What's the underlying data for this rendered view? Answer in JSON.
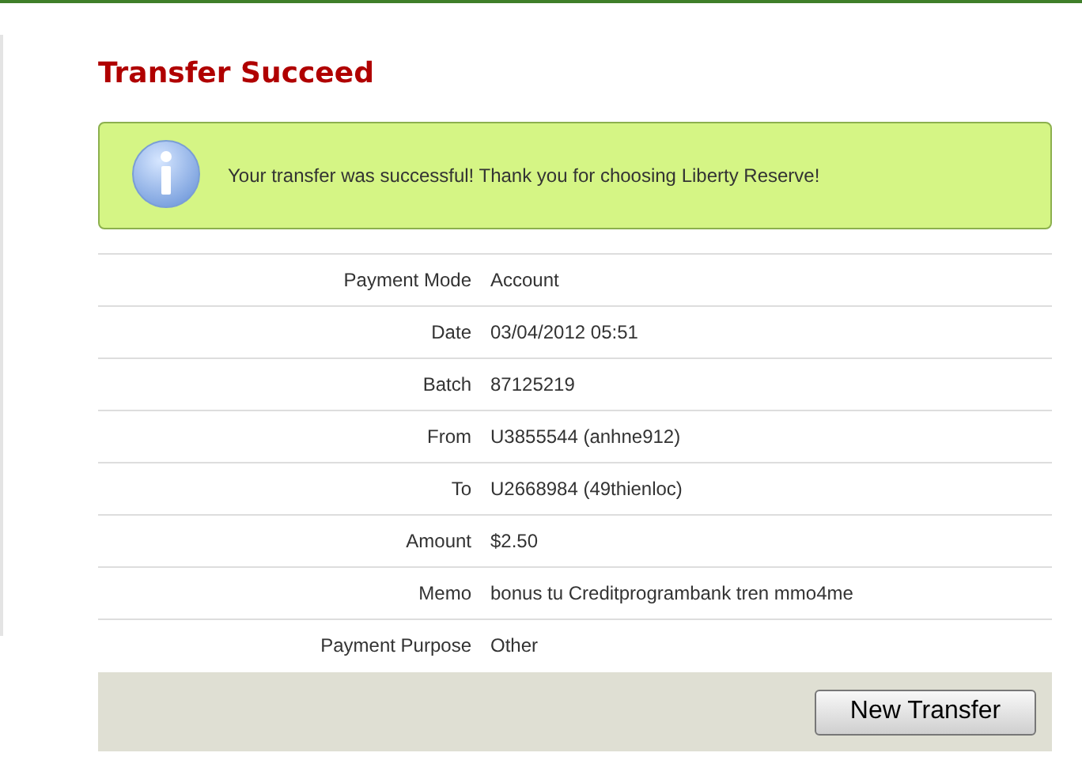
{
  "title": "Transfer Succeed",
  "message": "Your transfer was successful! Thank you for choosing Liberty Reserve!",
  "details": [
    {
      "label": "Payment Mode",
      "value": "Account"
    },
    {
      "label": "Date",
      "value": "03/04/2012 05:51"
    },
    {
      "label": "Batch",
      "value": "87125219"
    },
    {
      "label": "From",
      "value": "U3855544 (anhne912)"
    },
    {
      "label": "To",
      "value": "U2668984 (49thienloc)"
    },
    {
      "label": "Amount",
      "value": "$2.50"
    },
    {
      "label": "Memo",
      "value": "bonus tu Creditprogrambank tren mmo4me"
    },
    {
      "label": "Payment Purpose",
      "value": "Other"
    }
  ],
  "buttons": [
    "New Transfer"
  ]
}
